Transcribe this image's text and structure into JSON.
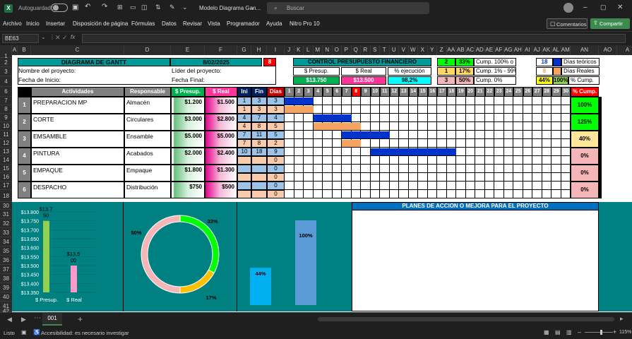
{
  "titlebar": {
    "app_icon": "excel-icon",
    "autosave_label": "Autoguardado",
    "doc_title": "Modelo Diagrama Gan...",
    "search_placeholder": "Buscar"
  },
  "menu": [
    "Archivo",
    "Inicio",
    "Insertar",
    "Disposición de página",
    "Fórmulas",
    "Datos",
    "Revisar",
    "Vista",
    "Programador",
    "Ayuda",
    "Nitro Pro 10"
  ],
  "menu_buttons": {
    "comments": "Comentarios",
    "share": "Compartir"
  },
  "formula": {
    "name_box": "BE63",
    "fx": "fx",
    "value": ""
  },
  "columns": [
    "A",
    "B",
    "C",
    "D",
    "E",
    "F",
    "G",
    "H",
    "I",
    "J",
    "K",
    "L",
    "M",
    "N",
    "O",
    "P",
    "Q",
    "R",
    "S",
    "T",
    "U",
    "V",
    "W",
    "X",
    "Y",
    "Z",
    "AA",
    "AB",
    "AC",
    "AD",
    "AE",
    "AF",
    "AG",
    "AH",
    "AI",
    "AJ",
    "AK",
    "AL",
    "AM",
    "AN",
    "AO",
    "A"
  ],
  "rows": [
    "1",
    "2",
    "3",
    "4",
    "6",
    "7",
    "8",
    "9",
    "10",
    "11",
    "12",
    "13",
    "14",
    "15",
    "16",
    "17",
    "18",
    "30",
    "31",
    "32",
    "33",
    "34",
    "35",
    "36",
    "37",
    "38",
    "39",
    "40",
    "41",
    "42"
  ],
  "header": {
    "title": "DIAGRAMA DE GANTT",
    "date": "8/02/2025",
    "red_num": "8",
    "project_name": "Nombre del proyecto:",
    "start_date": "Fecha de Inicio:",
    "leader": "Líder del proyecto:",
    "end_date": "Fecha Final:"
  },
  "control": {
    "title": "CONTROL PRESUPUESTO FINANCIERO",
    "presup_label": "$ Presup.",
    "real_label": "$ Real",
    "exec_label": "% ejecución",
    "presup_value": "$13.750",
    "real_value": "$13.500",
    "exec_value": "98,2%"
  },
  "legend": [
    {
      "n": "2",
      "pct": "33%",
      "label": "Cump. 100% o >",
      "color": "#00ff00"
    },
    {
      "n": "1",
      "pct": "17%",
      "label": "Cump. 1% - 99%",
      "color": "#ffd966"
    },
    {
      "n": "3",
      "pct": "50%",
      "label": "Cump. 0%",
      "color": "#f4b6b6"
    }
  ],
  "days_legend": [
    {
      "n": "18",
      "label": "Días teóricos",
      "color": "#0033cc"
    },
    {
      "n": "8",
      "label": "Días Reales",
      "color": "#f4a460"
    },
    {
      "n1": "44%",
      "n2": "100%",
      "label": "% Cump."
    }
  ],
  "table_headers": {
    "activities": "Actividades",
    "responsible": "Responsable",
    "presup": "$ Presup.",
    "real": "$ Real",
    "ini": "Ini",
    "fin": "Fin",
    "dias": "Días",
    "cump": "% Cump."
  },
  "days": [
    "1",
    "2",
    "3",
    "4",
    "5",
    "6",
    "7",
    "8",
    "9",
    "10",
    "11",
    "12",
    "13",
    "14",
    "15",
    "16",
    "17",
    "18",
    "19",
    "20",
    "21",
    "22",
    "23",
    "24",
    "25",
    "26",
    "27",
    "28",
    "29",
    "30"
  ],
  "activities": [
    {
      "num": "1",
      "name": "PREPARACION MP",
      "resp": "Almacén",
      "presup": "$1.200",
      "real": "$1.500",
      "ini1": "1",
      "fin1": "3",
      "d1": "3",
      "ini2": "1",
      "fin2": "3",
      "d2": "3",
      "cump": "100%",
      "cump_color": "#00ff00",
      "plan": [
        1,
        3
      ],
      "real_bar": [
        1,
        3
      ]
    },
    {
      "num": "2",
      "name": "CORTE",
      "resp": "Circulares",
      "presup": "$3.000",
      "real": "$2.800",
      "ini1": "4",
      "fin1": "7",
      "d1": "4",
      "ini2": "4",
      "fin2": "8",
      "d2": "5",
      "cump": "125%",
      "cump_color": "#00ff00",
      "plan": [
        4,
        7
      ],
      "real_bar": [
        4,
        8
      ]
    },
    {
      "num": "3",
      "name": "EMSAMBLE",
      "resp": "Ensamble",
      "presup": "$5.000",
      "real": "$5.000",
      "ini1": "7",
      "fin1": "11",
      "d1": "5",
      "ini2": "7",
      "fin2": "8",
      "d2": "2",
      "cump": "40%",
      "cump_color": "#ffe699",
      "plan": [
        7,
        11
      ],
      "real_bar": [
        7,
        8
      ]
    },
    {
      "num": "4",
      "name": "PINTURA",
      "resp": "Acabados",
      "presup": "$2.000",
      "real": "$2.400",
      "ini1": "10",
      "fin1": "18",
      "d1": "9",
      "ini2": "",
      "fin2": "",
      "d2": "0",
      "cump": "0%",
      "cump_color": "#f4b6b6",
      "plan": [
        10,
        18
      ],
      "real_bar": null
    },
    {
      "num": "5",
      "name": "EMPAQUE",
      "resp": "Empaque",
      "presup": "$1.800",
      "real": "$1.300",
      "ini1": "",
      "fin1": "",
      "d1": "0",
      "ini2": "",
      "fin2": "",
      "d2": "0",
      "cump": "0%",
      "cump_color": "#f4b6b6",
      "plan": null,
      "real_bar": null
    },
    {
      "num": "6",
      "name": "DESPACHO",
      "resp": "Distribución",
      "presup": "$750",
      "real": "$500",
      "ini1": "",
      "fin1": "",
      "d1": "0",
      "ini2": "",
      "fin2": "",
      "d2": "0",
      "cump": "0%",
      "cump_color": "#f4b6b6",
      "plan": null,
      "real_bar": null
    }
  ],
  "action_plan_title": "PLANES DE ACCION O MEJORA PARA EL PROYECTO",
  "tabs": {
    "sheet": "001"
  },
  "status": {
    "ready": "Listo",
    "accessibility": "Accesibilidad: es necesario investigar",
    "zoom": "115%"
  },
  "chart_data": [
    {
      "type": "bar",
      "categories": [
        "$ Presup.",
        "$ Real"
      ],
      "values": [
        13750,
        13500
      ],
      "data_labels": [
        "$13.7 50",
        "$13.5 00"
      ],
      "ylim": [
        13350,
        13800
      ],
      "yticks": [
        "$13.800",
        "$13.750",
        "$13.700",
        "$13.650",
        "$13.600",
        "$13.550",
        "$13.500",
        "$13.450",
        "$13.400",
        "$13.350"
      ],
      "colors": [
        "#92d050",
        "#ff99cc"
      ]
    },
    {
      "type": "pie",
      "categories": [
        "Cump. 100% o >",
        "Cump. 1% - 99%",
        "Cump. 0%"
      ],
      "values": [
        33,
        17,
        50
      ],
      "labels": [
        "33%",
        "17%",
        "50%"
      ],
      "colors": [
        "#00ff00",
        "#ffc000",
        "#f4b6b6"
      ]
    },
    {
      "type": "bar",
      "categories": [
        "Días Reales",
        "% Cump."
      ],
      "values": [
        44,
        100
      ],
      "labels": [
        "44%",
        "100%"
      ],
      "colors": [
        "#00b0f0",
        "#5b9bd5"
      ]
    }
  ]
}
